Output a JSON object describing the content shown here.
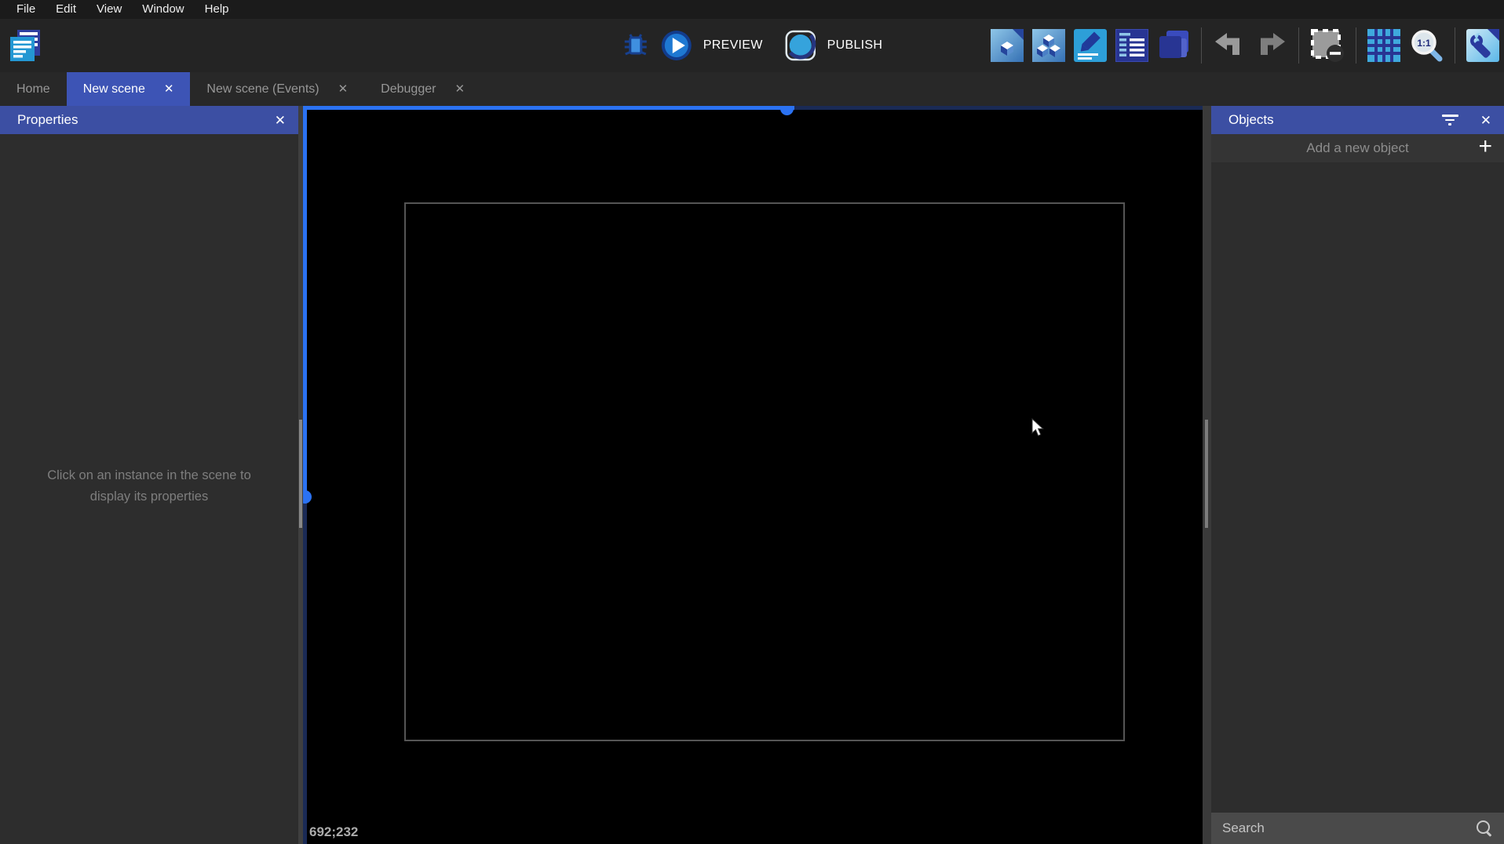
{
  "menu": {
    "items": [
      "File",
      "Edit",
      "View",
      "Window",
      "Help"
    ]
  },
  "toolbar": {
    "preview_label": "PREVIEW",
    "publish_label": "PUBLISH",
    "icon_names": [
      "app-logo",
      "debug-bug",
      "play-preview",
      "publish-globe",
      "open-objects-editor",
      "open-object-groups-editor",
      "open-scene-properties",
      "open-layers-list",
      "open-instances-list",
      "undo",
      "redo",
      "selection-mask",
      "toggle-grid",
      "zoom-1-1",
      "scene-settings"
    ]
  },
  "tabs": [
    {
      "label": "Home",
      "active": false,
      "closable": false
    },
    {
      "label": "New scene",
      "active": true,
      "closable": true
    },
    {
      "label": "New scene (Events)",
      "active": false,
      "closable": true
    },
    {
      "label": "Debugger",
      "active": false,
      "closable": true
    }
  ],
  "properties_panel": {
    "title": "Properties",
    "hint": "Click on an instance in the scene to display its properties"
  },
  "objects_panel": {
    "title": "Objects",
    "add_label": "Add a new object",
    "search_placeholder": "Search"
  },
  "canvas": {
    "coordinates": "692;232"
  },
  "icons": {
    "close": "✕",
    "plus": "+",
    "filter": "filter-list",
    "search": "magnifier"
  },
  "colors": {
    "header_blue": "#3c4fa3",
    "active_tab_blue": "#3d54b5",
    "accent_blue": "#2b72f2",
    "scrollbar_dark_blue": "#1a2a55",
    "canvas_black": "#000000",
    "panel_gray": "#2d2d2d"
  }
}
